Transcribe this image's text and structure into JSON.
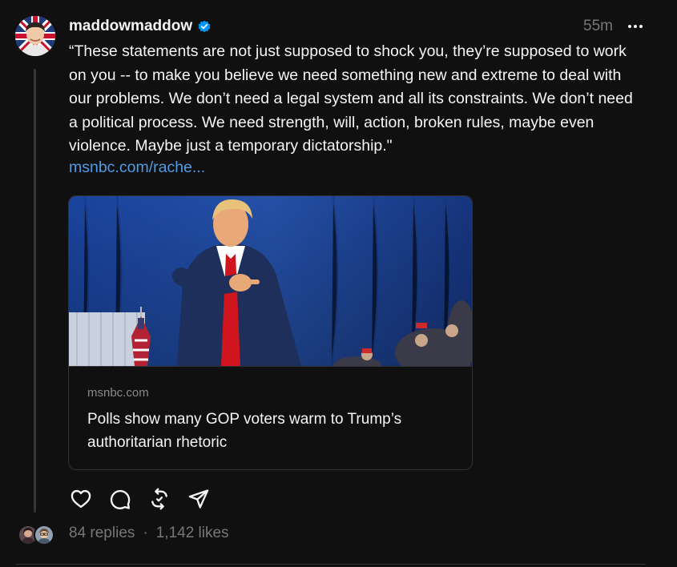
{
  "post": {
    "username": "maddowmaddow",
    "verified": true,
    "time": "55m",
    "text": "“These statements are not just supposed to shock you, they’re supposed to work on you -- to make you believe we need something new and extreme to deal with our problems. We don’t need a legal system and all its constraints. We don’t need a political process. We need strength, will, action, broken rules, maybe even violence. Maybe just a temporary dictatorship.\"",
    "link_text": "msnbc.com/rache...",
    "card": {
      "domain": "msnbc.com",
      "title": "Polls show many GOP voters warm to Trump’s authoritarian rhetoric"
    },
    "actions": [
      "heart-icon",
      "comment-icon",
      "repost-icon",
      "share-icon"
    ],
    "replies": "84 replies",
    "separator": "·",
    "likes": "1,142 likes"
  },
  "colors": {
    "background": "#101010",
    "text": "#f3f5f7",
    "muted": "#777777",
    "link": "#4f9ce8",
    "verified": "#0095f6",
    "border": "#323232"
  }
}
